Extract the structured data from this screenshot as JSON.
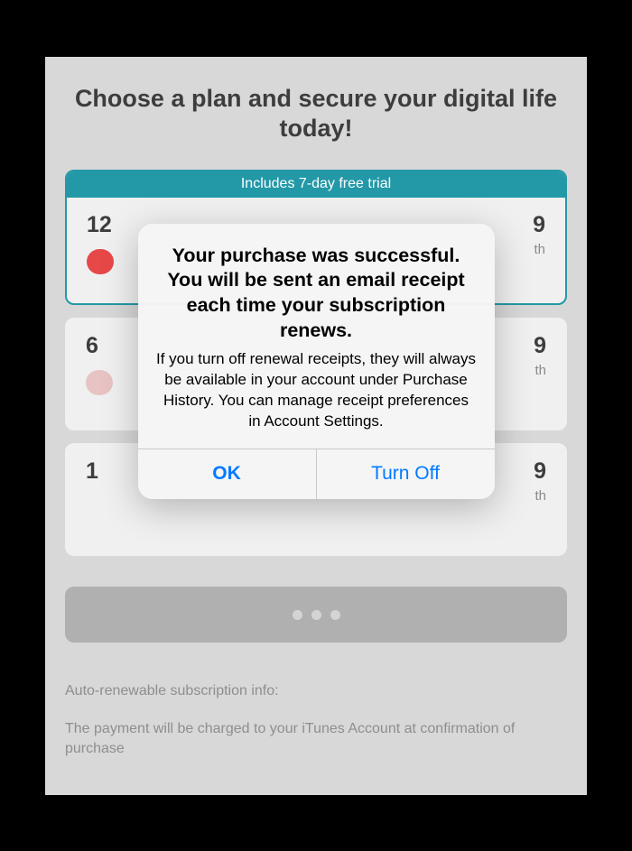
{
  "heading": "Choose a plan and secure your digital life today!",
  "plans": [
    {
      "banner": "Includes 7-day free trial",
      "duration_prefix": "12",
      "price_suffix": "9",
      "unit_suffix": "th"
    },
    {
      "duration_prefix": "6",
      "price_suffix": "9",
      "unit_suffix": "th"
    },
    {
      "duration_prefix": "1",
      "price_suffix": "9",
      "unit_suffix": "th"
    }
  ],
  "footer": {
    "title": "Auto-renewable subscription info:",
    "body": "The payment will be charged to your iTunes Account at confirmation of purchase"
  },
  "alert": {
    "title": "Your purchase was successful. You will be sent an email receipt each time your subscription renews.",
    "message": "If you turn off renewal receipts, they will always be available in your account under Purchase History. You can manage receipt preferences in Account Settings.",
    "ok": "OK",
    "turn_off": "Turn Off"
  }
}
